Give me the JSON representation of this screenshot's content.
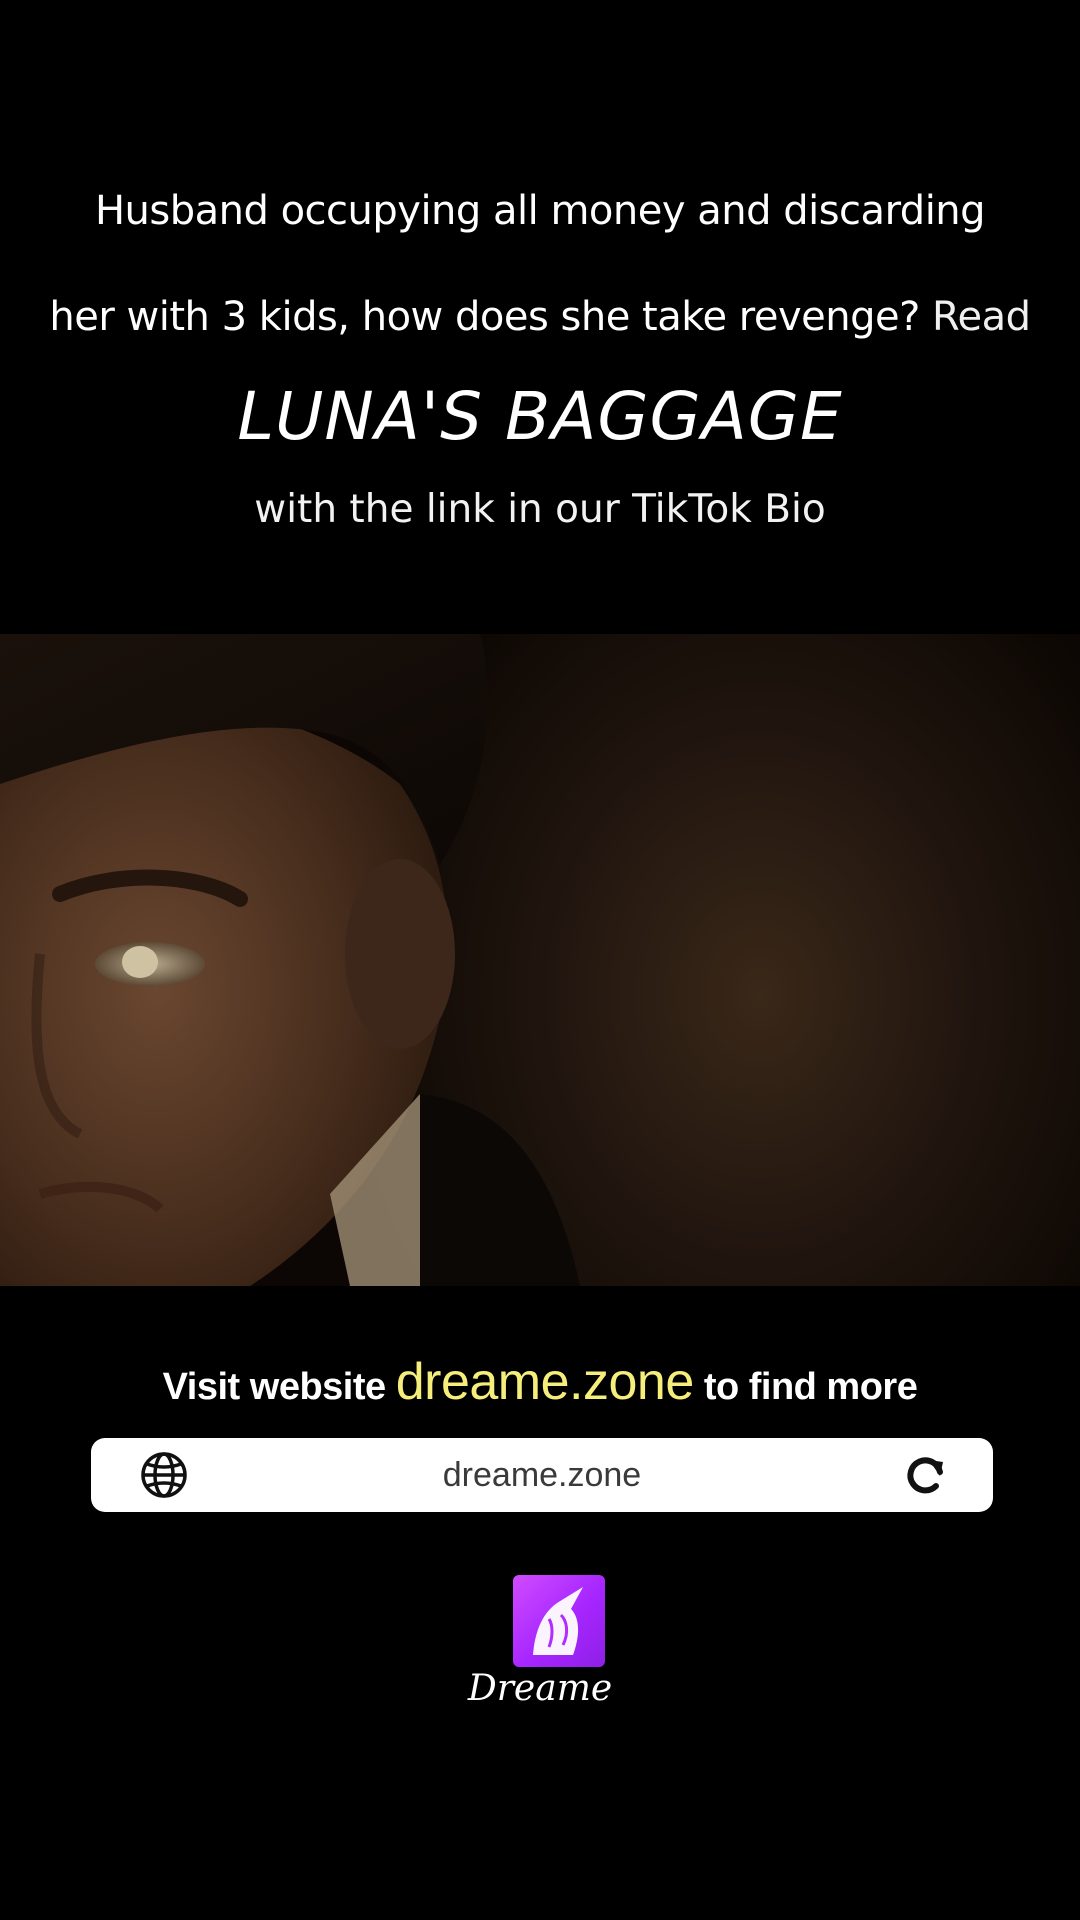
{
  "headline": {
    "line1": "Husband occupying all money and discarding",
    "line2": "her with 3 kids, how does she take revenge?",
    "read_word": "Read"
  },
  "book_title": "LUNA'S BAGGAGE",
  "sub_line": "with the link in our TikTok Bio",
  "video": {
    "content": "film still"
  },
  "promo": {
    "visit_prefix": "Visit website",
    "domain": "dreame.zone",
    "visit_suffix": "to find more"
  },
  "url_bar": {
    "url": "dreame.zone",
    "left_icon": "globe-icon",
    "right_icon": "reload-icon"
  },
  "brand": {
    "name": "Dreame",
    "logo_icon": "unicorn-logo-icon"
  },
  "colors": {
    "background": "#000000",
    "domain_highlight": "#f5ee7a",
    "logo_purple": "#b22cff"
  }
}
